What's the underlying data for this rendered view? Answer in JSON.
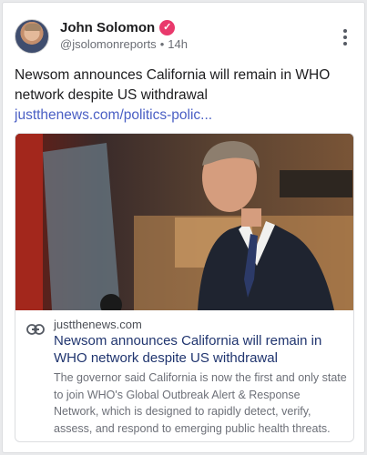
{
  "post": {
    "author_name": "John Solomon",
    "handle": "@jsolomonreports",
    "separator": "•",
    "time_ago": "14h",
    "text": "Newsom announces California will remain in WHO network despite US withdrawal ",
    "link_text": "justthenews.com/politics-polic...",
    "verified_icon": "verified-badge-icon",
    "menu_icon": "more-options-icon"
  },
  "preview": {
    "domain": "justthenews.com",
    "title": "Newsom announces California will remain in WHO network despite US withdrawal",
    "description": "The governor said California is now the first and only state to join WHO's Global Outbreak Alert & Response Network, which is designed to rapidly detect, verify, assess, and respond to emerging public health threats.",
    "icon": "link-icon"
  },
  "colors": {
    "link": "#4a5fc4",
    "title": "#20356f",
    "verified_badge": "#e9396c"
  }
}
